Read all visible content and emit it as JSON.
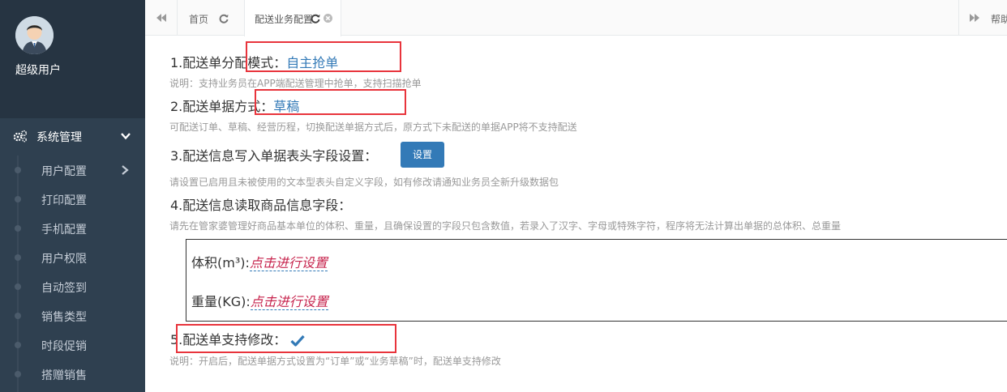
{
  "sidebar": {
    "user_name": "超级用户",
    "menu_head": "系统管理",
    "items": [
      {
        "label": "用户配置"
      },
      {
        "label": "打印配置"
      },
      {
        "label": "手机配置"
      },
      {
        "label": "用户权限"
      },
      {
        "label": "自动签到"
      },
      {
        "label": "销售类型"
      },
      {
        "label": "时段促销"
      },
      {
        "label": "搭赠销售"
      }
    ]
  },
  "tabs": {
    "home": "首页",
    "active": "配送业务配置",
    "help": "帮助"
  },
  "settings": {
    "s1_label": "1.配送单分配模式：",
    "s1_value": "自主抢单",
    "s1_hint": "说明：支持业务员在APP端配送管理中抢单，支持扫描抢单",
    "s2_label": "2.配送单据方式：",
    "s2_value": "草稿",
    "s2_hint": "可配送订单、草稿、经营历程，切换配送单据方式后，原方式下未配送的单据APP将不支持配送",
    "s3_label": "3.配送信息写入单据表头字段设置：",
    "s3_button": "设置",
    "s3_hint": "请设置已启用且未被使用的文本型表头自定义字段，如有修改请通知业务员全新升级数据包",
    "s4_label": "4.配送信息读取商品信息字段：",
    "s4_hint": "请先在管家婆管理好商品基本单位的体积、重量，且确保设置的字段只包含数值，若录入了汉字、字母或特殊字符，程序将无法计算出单据的总体积、总重量",
    "volume_label": "体积(m³):",
    "volume_link": "点击进行设置",
    "weight_label": "重量(KG):",
    "weight_link": "点击进行设置",
    "s5_label": "5.配送单支持修改：",
    "s5_checked": true,
    "s5_hint": "说明：开启后，配送单据方式设置为“订单”或“业务草稿”时，配送单支持修改"
  },
  "colors": {
    "sidebar_bg": "#2f4050",
    "link": "#337ab7",
    "highlight_box": "#e8343c",
    "button": "#337ab7"
  }
}
